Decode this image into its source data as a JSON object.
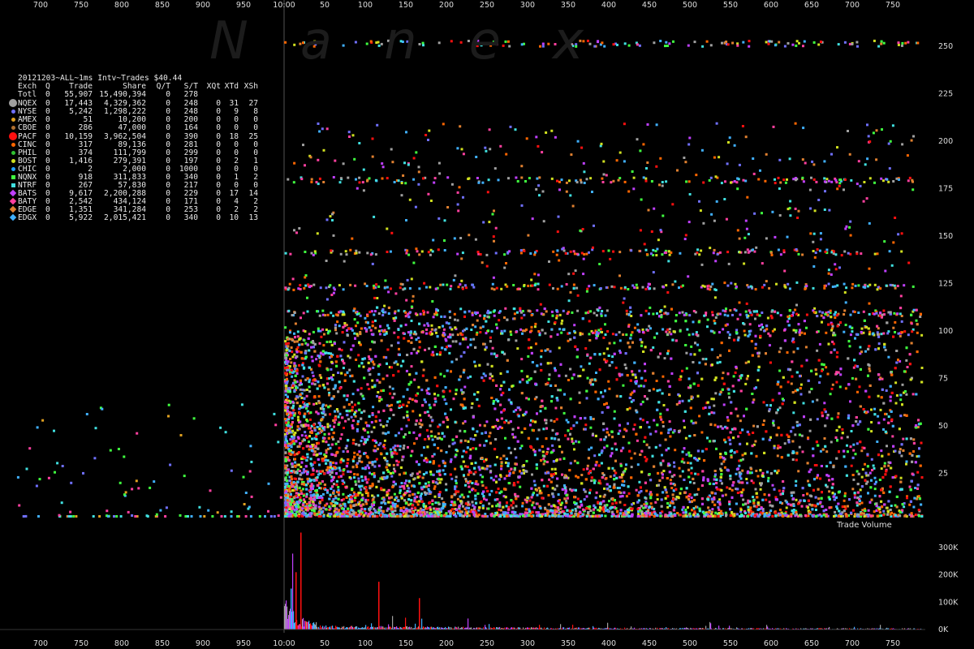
{
  "watermark": "Nanex",
  "stats_table": {
    "title": "20121203~ALL~1ms Intv~Trades $40.44",
    "columns": [
      "Exch",
      "Q",
      "Trade",
      "Share",
      "Q/T",
      "S/T",
      "XQt",
      "XTd",
      "XSh"
    ],
    "rows": [
      {
        "exch": "Totl",
        "q": "0",
        "trade": "55,907",
        "share": "15,490,394",
        "qt": "0",
        "st": "278",
        "xqt": "",
        "xtd": "",
        "xsh": "",
        "color": "",
        "marker": "none"
      },
      {
        "exch": "NQEX",
        "q": "0",
        "trade": "17,443",
        "share": "4,329,362",
        "qt": "0",
        "st": "248",
        "xqt": "0",
        "xtd": "31",
        "xsh": "27",
        "color": "#a0a0a0",
        "marker": "big-dot"
      },
      {
        "exch": "NYSE",
        "q": "0",
        "trade": "5,242",
        "share": "1,298,222",
        "qt": "0",
        "st": "248",
        "xqt": "0",
        "xtd": "9",
        "xsh": "8",
        "color": "#7070ff",
        "marker": "dot"
      },
      {
        "exch": "AMEX",
        "q": "0",
        "trade": "51",
        "share": "10,200",
        "qt": "0",
        "st": "200",
        "xqt": "0",
        "xtd": "0",
        "xsh": "0",
        "color": "#e0a020",
        "marker": "dot"
      },
      {
        "exch": "CBOE",
        "q": "0",
        "trade": "286",
        "share": "47,000",
        "qt": "0",
        "st": "164",
        "xqt": "0",
        "xtd": "0",
        "xsh": "0",
        "color": "#b07030",
        "marker": "dot"
      },
      {
        "exch": "PACF",
        "q": "0",
        "trade": "10,159",
        "share": "3,962,504",
        "qt": "0",
        "st": "390",
        "xqt": "0",
        "xtd": "18",
        "xsh": "25",
        "color": "#ff1010",
        "marker": "big-dot"
      },
      {
        "exch": "CINC",
        "q": "0",
        "trade": "317",
        "share": "89,136",
        "qt": "0",
        "st": "281",
        "xqt": "0",
        "xtd": "0",
        "xsh": "0",
        "color": "#ff6600",
        "marker": "dot"
      },
      {
        "exch": "PHIL",
        "q": "0",
        "trade": "374",
        "share": "111,799",
        "qt": "0",
        "st": "299",
        "xqt": "0",
        "xtd": "0",
        "xsh": "0",
        "color": "#30c030",
        "marker": "dot"
      },
      {
        "exch": "BOST",
        "q": "0",
        "trade": "1,416",
        "share": "279,391",
        "qt": "0",
        "st": "197",
        "xqt": "0",
        "xtd": "2",
        "xsh": "1",
        "color": "#d0e020",
        "marker": "dot"
      },
      {
        "exch": "CHIC",
        "q": "0",
        "trade": "2",
        "share": "2,000",
        "qt": "0",
        "st": "1000",
        "xqt": "0",
        "xtd": "0",
        "xsh": "0",
        "color": "#20a0ff",
        "marker": "dot"
      },
      {
        "exch": "NQNX",
        "q": "0",
        "trade": "918",
        "share": "311,833",
        "qt": "0",
        "st": "340",
        "xqt": "0",
        "xtd": "1",
        "xsh": "2",
        "color": "#40ff40",
        "marker": "square"
      },
      {
        "exch": "NTRF",
        "q": "0",
        "trade": "267",
        "share": "57,830",
        "qt": "0",
        "st": "217",
        "xqt": "0",
        "xtd": "0",
        "xsh": "0",
        "color": "#40e0e0",
        "marker": "square"
      },
      {
        "exch": "BATS",
        "q": "0",
        "trade": "9,617",
        "share": "2,200,288",
        "qt": "0",
        "st": "229",
        "xqt": "0",
        "xtd": "17",
        "xsh": "14",
        "color": "#c040ff",
        "marker": "diamond"
      },
      {
        "exch": "BATY",
        "q": "0",
        "trade": "2,542",
        "share": "434,124",
        "qt": "0",
        "st": "171",
        "xqt": "0",
        "xtd": "4",
        "xsh": "2",
        "color": "#ff40a0",
        "marker": "diamond"
      },
      {
        "exch": "EDGE",
        "q": "0",
        "trade": "1,351",
        "share": "341,284",
        "qt": "0",
        "st": "253",
        "xqt": "0",
        "xtd": "2",
        "xsh": "2",
        "color": "#e08030",
        "marker": "diamond"
      },
      {
        "exch": "EDGX",
        "q": "0",
        "trade": "5,922",
        "share": "2,015,421",
        "qt": "0",
        "st": "340",
        "xqt": "0",
        "xtd": "10",
        "xsh": "13",
        "color": "#40b0ff",
        "marker": "diamond"
      }
    ]
  },
  "chart_data": [
    {
      "type": "scatter",
      "title": "",
      "xlabel": "",
      "ylabel": "",
      "x_ticks": [
        "700",
        "750",
        "800",
        "850",
        "900",
        "950",
        "10:00",
        "50",
        "100",
        "150",
        "200",
        "250",
        "300",
        "350",
        "400",
        "450",
        "500",
        "550",
        "600",
        "650",
        "700",
        "750"
      ],
      "x_tick_ms": [
        -300,
        -250,
        -200,
        -150,
        -100,
        -50,
        0,
        50,
        100,
        150,
        200,
        250,
        300,
        350,
        400,
        450,
        500,
        550,
        600,
        650,
        700,
        750
      ],
      "xlim": [
        -343,
        787
      ],
      "y_ticks": [
        "25",
        "50",
        "75",
        "100",
        "125",
        "150",
        "175",
        "200",
        "225",
        "250"
      ],
      "ylim": [
        0,
        270
      ],
      "grid": false,
      "description_points": "dense cloud of trade-size points colored by exchange; most between 0 and 100 after 10:00, sparse before",
      "series_colors": [
        "#a0a0a0",
        "#7070ff",
        "#ff1010",
        "#c040ff",
        "#40b0ff",
        "#ff40a0",
        "#40ff40",
        "#e08030",
        "#d0e020",
        "#40e0e0",
        "#ff6600"
      ],
      "band_levels": [
        252,
        180,
        142,
        124,
        110,
        100
      ],
      "legend": "top-left"
    },
    {
      "type": "bar",
      "title": "Trade Volume",
      "y_ticks": [
        "0K",
        "100K",
        "200K",
        "300K"
      ],
      "ylim": [
        0,
        330000
      ],
      "peaks": [
        {
          "x": 20,
          "value": 355000,
          "color": "#ff1010"
        },
        {
          "x": 14,
          "value": 210000,
          "color": "#ff1010"
        },
        {
          "x": 116,
          "value": 175000,
          "color": "#ff1010"
        },
        {
          "x": 166,
          "value": 115000,
          "color": "#ff1010"
        },
        {
          "x": 8,
          "value": 150000,
          "color": "#40b0ff"
        }
      ],
      "series_colors": [
        "#a0a0a0",
        "#ff1010",
        "#40b0ff",
        "#c040ff"
      ]
    }
  ]
}
